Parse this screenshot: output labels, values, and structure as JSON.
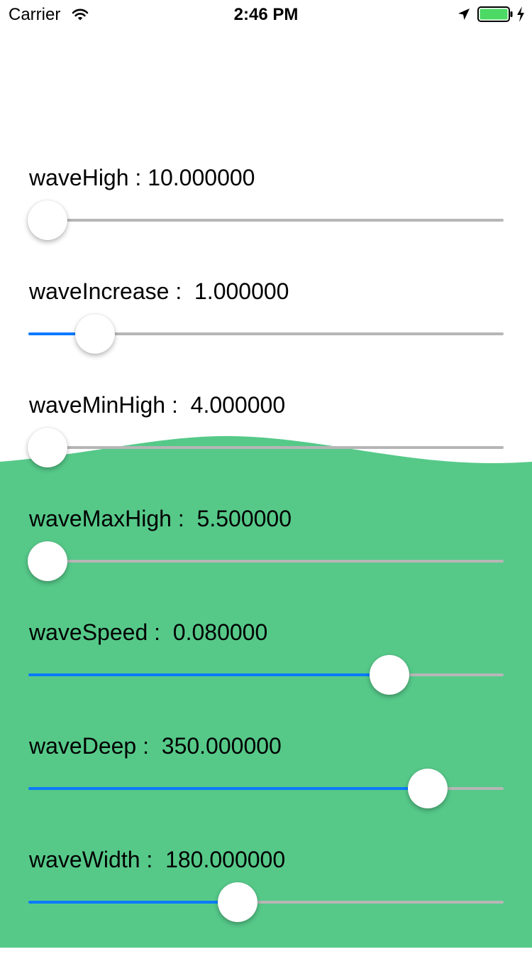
{
  "status_bar": {
    "carrier": "Carrier",
    "time": "2:46 PM",
    "icons": [
      "wifi-icon",
      "location-arrow-icon",
      "battery-icon",
      "charging-bolt-icon"
    ]
  },
  "colors": {
    "wave": "#56c989",
    "slider_min_track": "#0a7aff",
    "slider_max_track": "#b6b6b6",
    "battery": "#4cd964",
    "background": "#ffffff"
  },
  "controls": [
    {
      "name": "waveHigh",
      "label": "waveHigh : 10.000000",
      "position": 0.04
    },
    {
      "name": "waveIncrease",
      "label": "waveIncrease :  1.000000",
      "position": 0.14
    },
    {
      "name": "waveMinHigh",
      "label": "waveMinHigh :  4.000000",
      "position": 0.04
    },
    {
      "name": "waveMaxHigh",
      "label": "waveMaxHigh :  5.500000",
      "position": 0.04
    },
    {
      "name": "waveSpeed",
      "label": "waveSpeed :  0.080000",
      "position": 0.76
    },
    {
      "name": "waveDeep",
      "label": "waveDeep :  350.000000",
      "position": 0.84
    },
    {
      "name": "waveWidth",
      "label": "waveWidth :  180.000000",
      "position": 0.44
    }
  ]
}
